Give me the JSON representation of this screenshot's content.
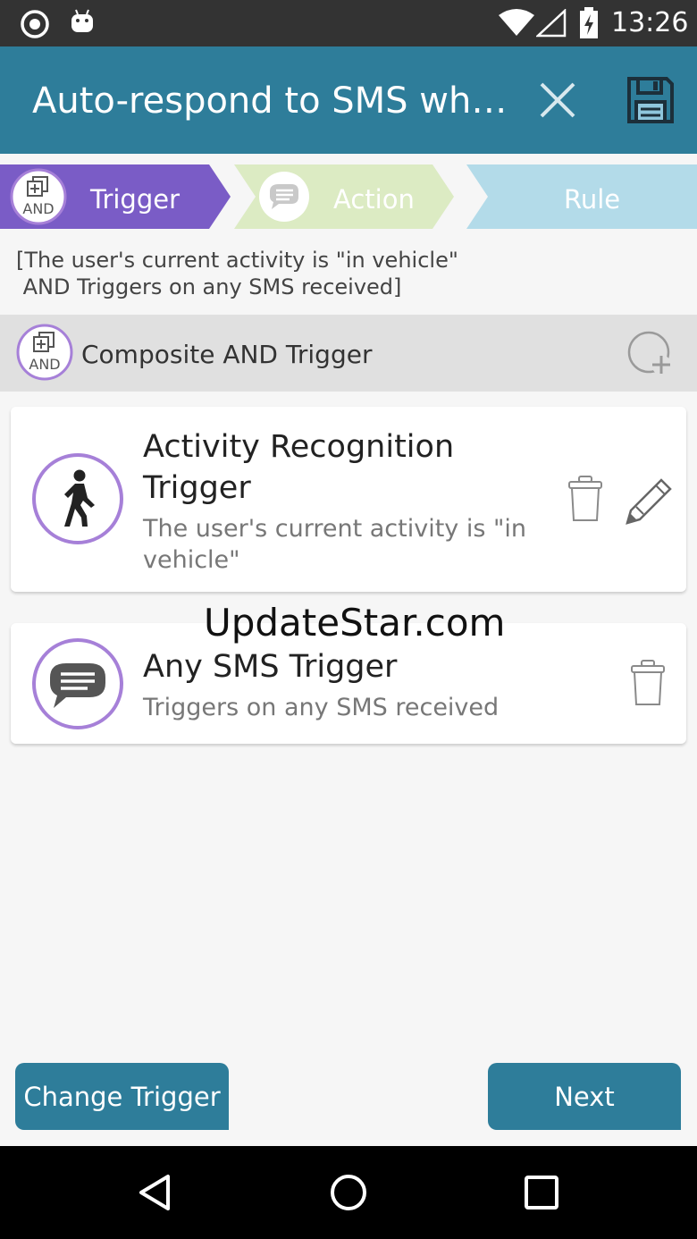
{
  "status_bar": {
    "time": "13:26"
  },
  "app_bar": {
    "title": "Auto-respond to SMS wh…"
  },
  "steps": {
    "trigger": {
      "label": "Trigger",
      "icon_text": "AND"
    },
    "action": {
      "label": "Action"
    },
    "rule": {
      "label": "Rule"
    }
  },
  "rule_summary": "[The user's current activity is \"in vehicle\"\n AND Triggers on any SMS received]",
  "composite": {
    "title": "Composite AND Trigger",
    "icon_text": "AND"
  },
  "triggers": [
    {
      "title_line1": "Activity Recognition",
      "title_line2": "Trigger",
      "subtitle_line1": "The user's current activity is \"in",
      "subtitle_line2": "vehicle\""
    },
    {
      "title_line1": "Any SMS Trigger",
      "subtitle_line1": "Triggers on any SMS received"
    }
  ],
  "watermark": "UpdateStar.com",
  "buttons": {
    "change_trigger": "Change Trigger",
    "next": "Next"
  },
  "colors": {
    "app_bar": "#2e7d9a",
    "trigger_step": "#7a5cc6",
    "action_step": "#dcebc3",
    "rule_step": "#b3dbe9",
    "icon_ring": "#a680d8"
  }
}
